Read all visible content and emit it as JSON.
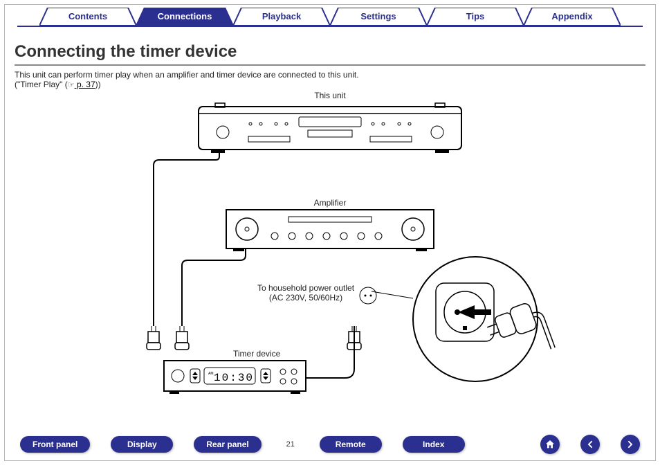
{
  "tabs": {
    "items": [
      {
        "label": "Contents"
      },
      {
        "label": "Connections"
      },
      {
        "label": "Playback"
      },
      {
        "label": "Settings"
      },
      {
        "label": "Tips"
      },
      {
        "label": "Appendix"
      }
    ],
    "active_index": 1
  },
  "page": {
    "title": "Connecting the timer device",
    "intro_line1": "This unit can perform timer play when an amplifier and timer device are connected to this unit.",
    "intro_ref_prefix": "(\"Timer Play\" (",
    "intro_ref_link": " p. 37",
    "intro_ref_suffix": "))"
  },
  "diagram": {
    "label_this_unit": "This unit",
    "label_amplifier": "Amplifier",
    "label_outlet_l1": "To household power outlet",
    "label_outlet_l2": "(AC 230V, 50/60Hz)",
    "label_timer_device": "Timer device",
    "timer_display": "10:30",
    "timer_ampm": "AM"
  },
  "bottom": {
    "items": [
      {
        "label": "Front panel"
      },
      {
        "label": "Display"
      },
      {
        "label": "Rear panel"
      },
      {
        "label": "Remote"
      },
      {
        "label": "Index"
      }
    ],
    "page_number": "21"
  },
  "colors": {
    "navy": "#2b2f8f"
  }
}
